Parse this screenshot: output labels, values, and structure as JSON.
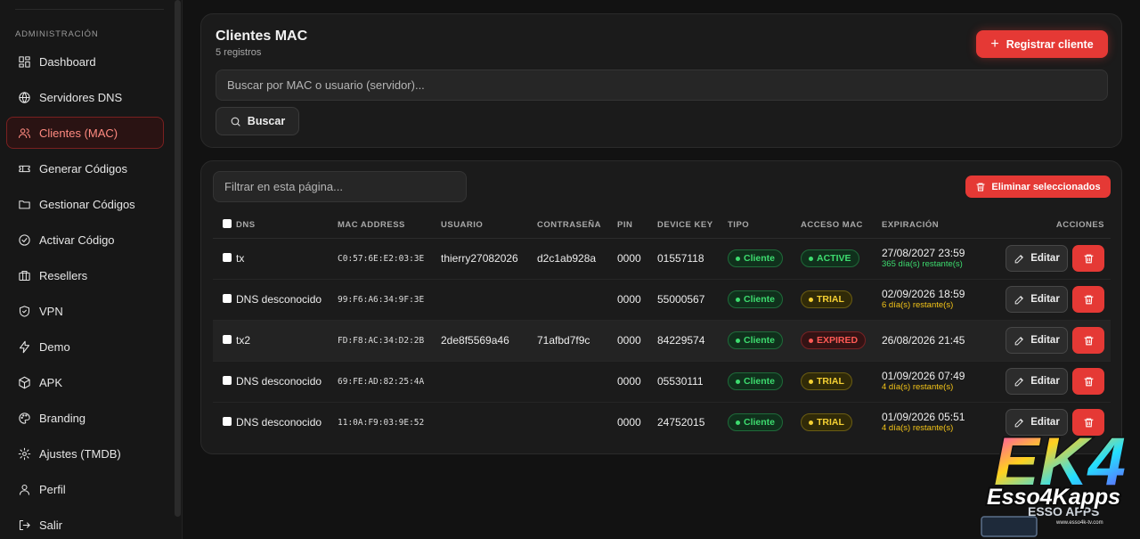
{
  "sidebar": {
    "section_label": "ADMINISTRACIÓN",
    "items": [
      {
        "label": "Dashboard",
        "icon": "dashboard-icon",
        "active": false
      },
      {
        "label": "Servidores DNS",
        "icon": "globe-icon",
        "active": false
      },
      {
        "label": "Clientes (MAC)",
        "icon": "users-icon",
        "active": true
      },
      {
        "label": "Generar Códigos",
        "icon": "ticket-icon",
        "active": false
      },
      {
        "label": "Gestionar Códigos",
        "icon": "folder-icon",
        "active": false
      },
      {
        "label": "Activar Código",
        "icon": "check-circle-icon",
        "active": false
      },
      {
        "label": "Resellers",
        "icon": "briefcase-icon",
        "active": false
      },
      {
        "label": "VPN",
        "icon": "shield-icon",
        "active": false
      },
      {
        "label": "Demo",
        "icon": "bolt-icon",
        "active": false
      },
      {
        "label": "APK",
        "icon": "package-icon",
        "active": false
      },
      {
        "label": "Branding",
        "icon": "palette-icon",
        "active": false
      },
      {
        "label": "Ajustes (TMDB)",
        "icon": "gear-icon",
        "active": false
      },
      {
        "label": "Perfil",
        "icon": "user-icon",
        "active": false
      },
      {
        "label": "Salir",
        "icon": "logout-icon",
        "active": false
      }
    ]
  },
  "header": {
    "title": "Clientes MAC",
    "subtitle": "5 registros",
    "register_label": "Registrar cliente",
    "search_placeholder": "Buscar por MAC o usuario (servidor)...",
    "search_button": "Buscar"
  },
  "table_panel": {
    "filter_placeholder": "Filtrar en esta página...",
    "delete_selected_label": "Eliminar seleccionados",
    "columns": [
      "DNS",
      "MAC ADDRESS",
      "USUARIO",
      "CONTRASEÑA",
      "PIN",
      "DEVICE KEY",
      "TIPO",
      "ACCESO MAC",
      "EXPIRACIÓN",
      "ACCIONES"
    ],
    "edit_label": "Editar",
    "rows": [
      {
        "dns": "tx",
        "mac": "C0:57:6E:E2:03:3E",
        "usuario": "thierry27082026",
        "password": "d2c1ab928a",
        "pin": "0000",
        "device_key": "01557118",
        "tipo": "Cliente",
        "acceso": "ACTIVE",
        "acceso_style": "green",
        "exp_date": "27/08/2027 23:59",
        "exp_remaining": "365 día(s) restante(s)",
        "exp_color": "#3ddc6f",
        "highlight": false
      },
      {
        "dns": "DNS desconocido",
        "mac": "99:F6:A6:34:9F:3E",
        "usuario": "",
        "password": "",
        "pin": "0000",
        "device_key": "55000567",
        "tipo": "Cliente",
        "acceso": "TRIAL",
        "acceso_style": "yellow",
        "exp_date": "02/09/2026 18:59",
        "exp_remaining": "6 día(s) restante(s)",
        "exp_color": "#f5c518",
        "highlight": false
      },
      {
        "dns": "tx2",
        "mac": "FD:F8:AC:34:D2:2B",
        "usuario": "2de8f5569a46",
        "password": "71afbd7f9c",
        "pin": "0000",
        "device_key": "84229574",
        "tipo": "Cliente",
        "acceso": "EXPIRED",
        "acceso_style": "red",
        "exp_date": "26/08/2026 21:45",
        "exp_remaining": "",
        "exp_color": "#f5c518",
        "highlight": true
      },
      {
        "dns": "DNS desconocido",
        "mac": "69:FE:AD:82:25:4A",
        "usuario": "",
        "password": "",
        "pin": "0000",
        "device_key": "05530111",
        "tipo": "Cliente",
        "acceso": "TRIAL",
        "acceso_style": "yellow",
        "exp_date": "01/09/2026 07:49",
        "exp_remaining": "4 día(s) restante(s)",
        "exp_color": "#f5c518",
        "highlight": false
      },
      {
        "dns": "DNS desconocido",
        "mac": "11:0A:F9:03:9E:52",
        "usuario": "",
        "password": "",
        "pin": "0000",
        "device_key": "24752015",
        "tipo": "Cliente",
        "acceso": "TRIAL",
        "acceso_style": "yellow",
        "exp_date": "01/09/2026 05:51",
        "exp_remaining": "4 día(s) restante(s)",
        "exp_color": "#f5c518",
        "highlight": false
      }
    ]
  },
  "logo": {
    "mark": "EK4",
    "wordmark": "Esso4Kapps",
    "url": "www.esso4k-tv.com",
    "background_text": "ESSO APPS"
  },
  "colors": {
    "accent": "#e53935",
    "background": "#121212",
    "card": "#1b1b1b"
  }
}
